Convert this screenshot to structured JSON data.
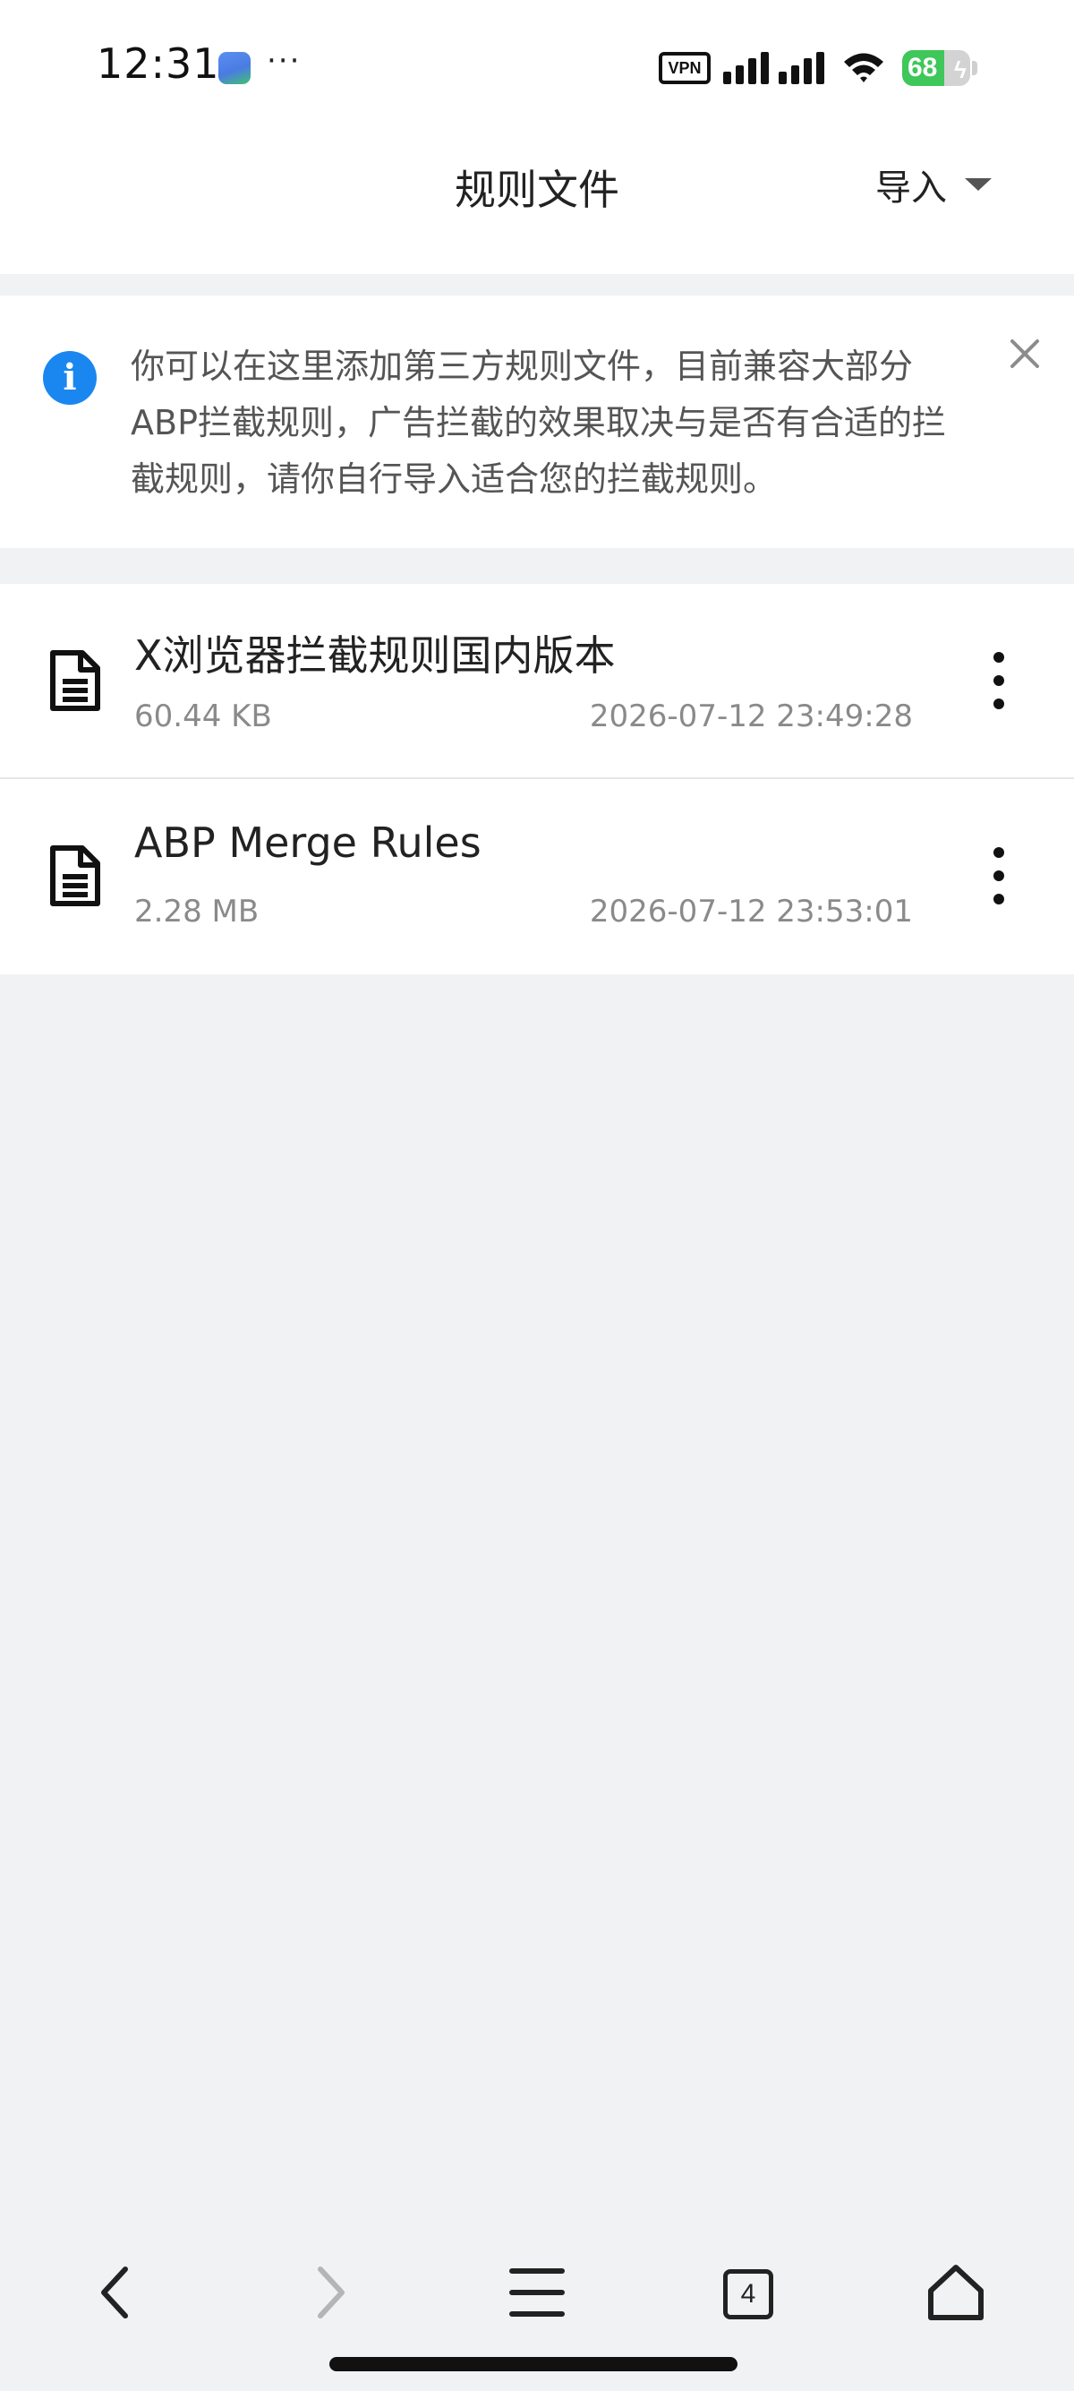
{
  "status_bar": {
    "time": "12:31",
    "more": "···",
    "vpn": "VPN",
    "battery": "68"
  },
  "header": {
    "title": "规则文件",
    "import_label": "导入"
  },
  "notice": {
    "text": "你可以在这里添加第三方规则文件，目前兼容大部分ABP拦截规则，广告拦截的效果取决与是否有合适的拦截规则，请你自行导入适合您的拦截规则。"
  },
  "files": [
    {
      "name": "X浏览器拦截规则国内版本",
      "size": "60.44 KB",
      "date": "2026-07-12 23:49:28"
    },
    {
      "name": "ABP Merge Rules",
      "size": "2.28 MB",
      "date": "2026-07-12 23:53:01"
    }
  ],
  "toolbar": {
    "tab_count": "4"
  },
  "colors": {
    "accent": "#1a87f0",
    "background": "#f1f2f4",
    "battery": "#3fc75a"
  },
  "icons": {
    "back": "chevron-left-icon",
    "forward": "chevron-right-icon",
    "menu": "hamburger-menu-icon",
    "tabs": "tabs-icon",
    "home": "home-icon",
    "file": "document-icon",
    "more": "more-vertical-icon",
    "info": "info-icon",
    "close": "close-icon"
  }
}
